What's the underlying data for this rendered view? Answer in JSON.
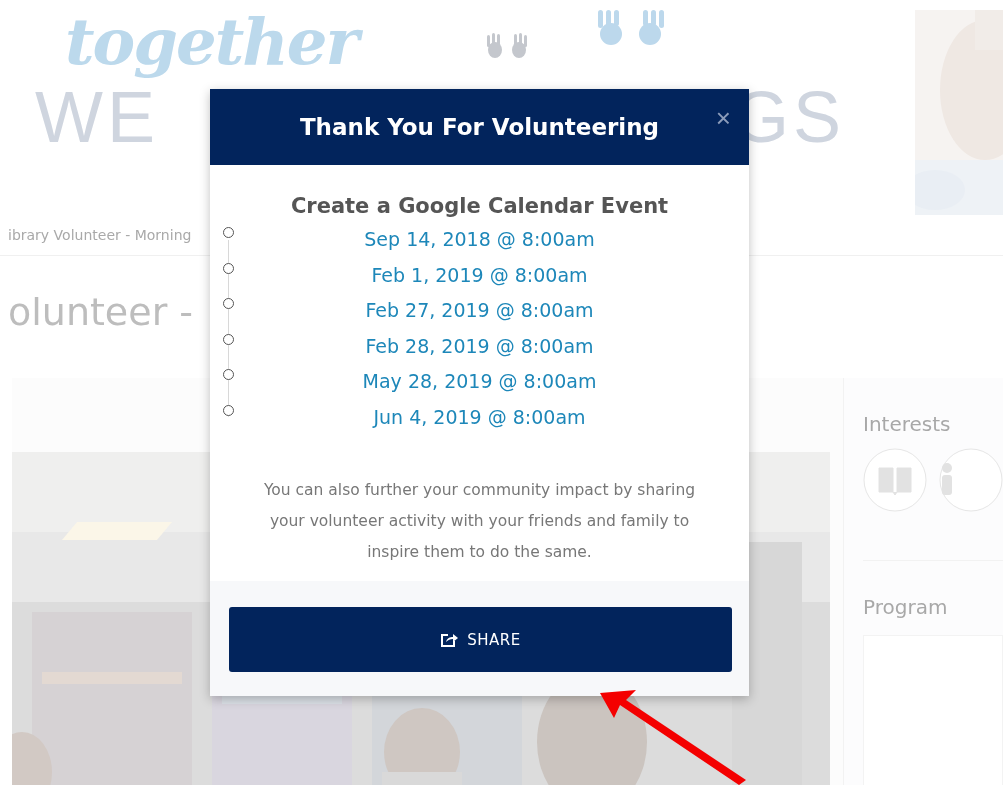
{
  "page": {
    "logo": {
      "script": "together",
      "left": "WE",
      "right": "GS"
    },
    "breadcrumb": "ibrary Volunteer - Morning",
    "heading": "olunteer -",
    "sidebar": [
      {
        "title": "Interests",
        "kind": "icons"
      },
      {
        "title": "Program",
        "kind": "box"
      }
    ]
  },
  "modal": {
    "title": "Thank You For Volunteering",
    "close": "×",
    "subtitle": "Create a Google Calendar Event",
    "dates": [
      "Sep 14, 2018 @ 8:00am",
      "Feb 1, 2019 @ 8:00am",
      "Feb 27, 2019 @ 8:00am",
      "Feb 28, 2019 @ 8:00am",
      "May 28, 2019 @ 8:00am",
      "Jun 4, 2019 @ 8:00am"
    ],
    "message": "You can also further your community impact by sharing your volunteer activity with your friends and family to inspire them to do the same.",
    "button": "SHARE"
  }
}
